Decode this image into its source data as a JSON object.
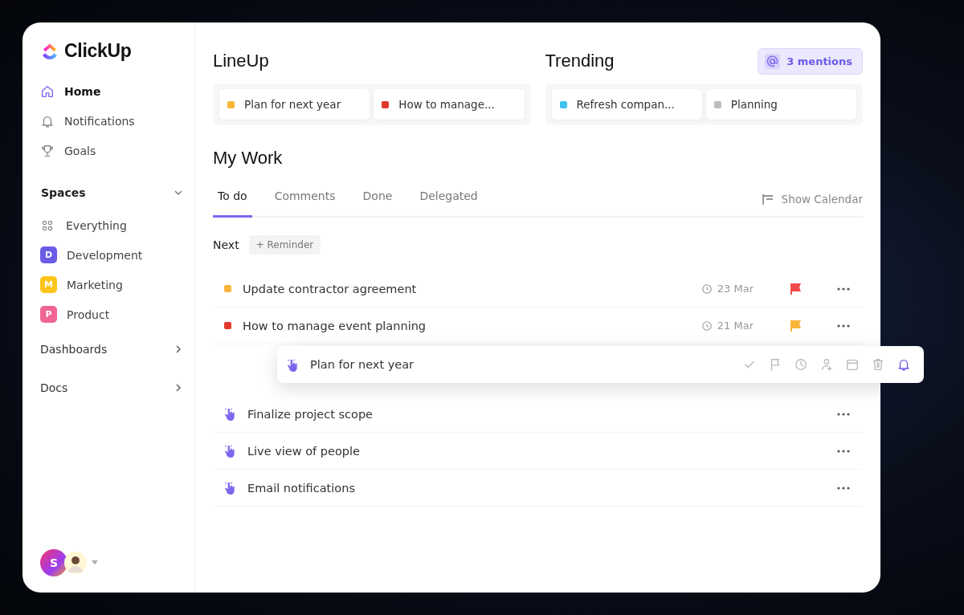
{
  "sidebar": {
    "logo": "ClickUp",
    "nav": [
      {
        "label": "Home",
        "selected": true
      },
      {
        "label": "Notifications",
        "selected": false
      },
      {
        "label": "Goals",
        "selected": false
      }
    ],
    "spaces_heading": "Spaces",
    "spaces_expanded": true,
    "spaces": [
      {
        "kind": "all",
        "label": "Everything"
      },
      {
        "kind": "space",
        "letter": "D",
        "label": "Development",
        "color": "#6b5ce7"
      },
      {
        "kind": "space",
        "letter": "M",
        "label": "Marketing",
        "color": "#fcc419"
      },
      {
        "kind": "space",
        "letter": "P",
        "label": "Product",
        "color": "#f06595"
      }
    ],
    "sections": [
      {
        "label": "Dashboards"
      },
      {
        "label": "Docs"
      }
    ],
    "user": {
      "initial": "S"
    }
  },
  "lineup": {
    "title": "LineUp",
    "items": [
      {
        "label": "Plan for next year",
        "color": "#f8b538"
      },
      {
        "label": "How to manage...",
        "color": "#e03a2b"
      }
    ]
  },
  "trending": {
    "title": "Trending",
    "items": [
      {
        "label": "Refresh compan...",
        "color": "#3fc1f0"
      },
      {
        "label": "Planning",
        "color": "#bdbdbd"
      }
    ]
  },
  "mentions": "3 mentions",
  "my_work": {
    "title": "My Work",
    "tabs": [
      {
        "label": "To do",
        "selected": true
      },
      {
        "label": "Comments",
        "selected": false
      },
      {
        "label": "Done",
        "selected": false
      },
      {
        "label": "Delegated",
        "selected": false
      }
    ],
    "show_calendar": "Show Calendar",
    "group": "Next",
    "reminder": "+ Reminder",
    "tasks": [
      {
        "kind": "status",
        "label": "Update contractor agreement",
        "color": "#f8b538",
        "date": "23 Mar",
        "flag": {
          "color": "#f04b4b"
        }
      },
      {
        "kind": "status",
        "label": "How to manage event planning",
        "color": "#e03a2b",
        "date": "21 Mar",
        "flag": {
          "color": "#f8b538"
        }
      },
      {
        "kind": "dragged",
        "label": "Plan for next year",
        "actions": [
          {
            "selected": false
          },
          {
            "selected": false
          },
          {
            "selected": false
          },
          {
            "selected": false
          },
          {
            "selected": false
          },
          {
            "selected": false
          },
          {
            "selected": true
          }
        ]
      },
      {
        "kind": "drag",
        "label": "Finalize project scope"
      },
      {
        "kind": "drag",
        "label": "Live view of people"
      },
      {
        "kind": "drag",
        "label": "Email notifications"
      }
    ]
  }
}
